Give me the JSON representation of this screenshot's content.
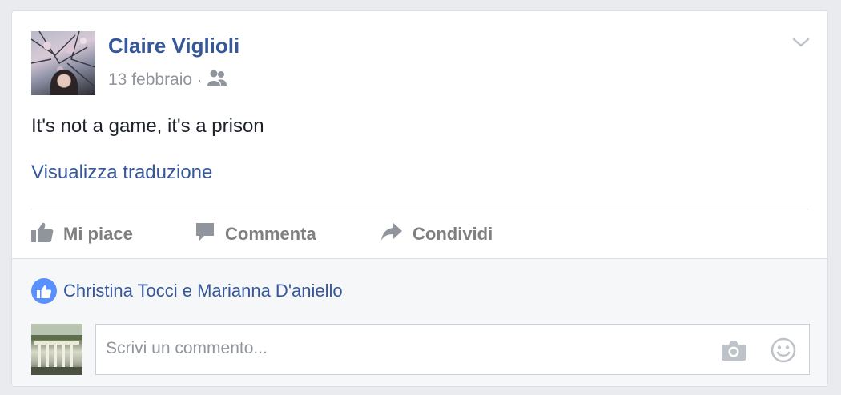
{
  "post": {
    "author": "Claire Viglioli",
    "date": "13 febbraio",
    "separator": "·",
    "audience_icon": "friends-icon",
    "text": "It's not a game, it's a prison",
    "translate_link": "Visualizza traduzione"
  },
  "actions": {
    "like": "Mi piace",
    "comment": "Commenta",
    "share": "Condividi"
  },
  "reactions": {
    "likers": "Christina Tocci e Marianna D'aniello"
  },
  "comment_input": {
    "placeholder": "Scrivi un commento..."
  },
  "colors": {
    "link": "#365899",
    "muted": "#90949c",
    "like_badge": "#5890ff",
    "background": "#e9ebee"
  }
}
